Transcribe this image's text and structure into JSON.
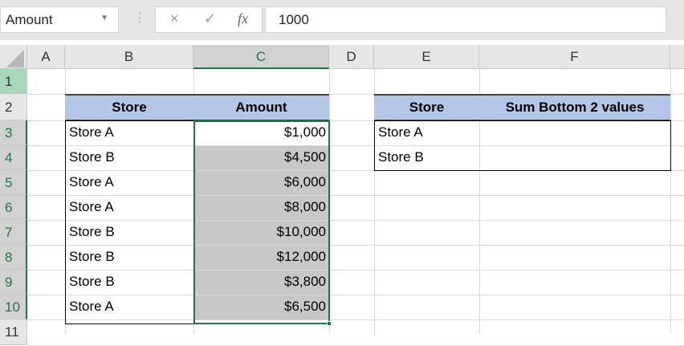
{
  "formula_bar": {
    "name_box": "Amount",
    "cancel_icon": "×",
    "enter_icon": "✓",
    "fx_label": "fx",
    "formula": "1000"
  },
  "columns": [
    "A",
    "B",
    "C",
    "D",
    "E",
    "F"
  ],
  "rows": [
    "1",
    "2",
    "3",
    "4",
    "5",
    "6",
    "7",
    "8",
    "9",
    "10",
    "11"
  ],
  "table1": {
    "headers": [
      "Store",
      "Amount"
    ],
    "rows": [
      [
        "Store A",
        "$1,000"
      ],
      [
        "Store B",
        "$4,500"
      ],
      [
        "Store A",
        "$6,000"
      ],
      [
        "Store A",
        "$8,000"
      ],
      [
        "Store B",
        "$10,000"
      ],
      [
        "Store B",
        "$12,000"
      ],
      [
        "Store B",
        "$3,800"
      ],
      [
        "Store A",
        "$6,500"
      ]
    ]
  },
  "table2": {
    "headers": [
      "Store",
      "Sum Bottom 2 values"
    ],
    "rows": [
      [
        "Store A",
        ""
      ],
      [
        "Store B",
        ""
      ]
    ]
  },
  "colors": {
    "header_fill": "#b4c6e7",
    "selection": "#217346"
  }
}
